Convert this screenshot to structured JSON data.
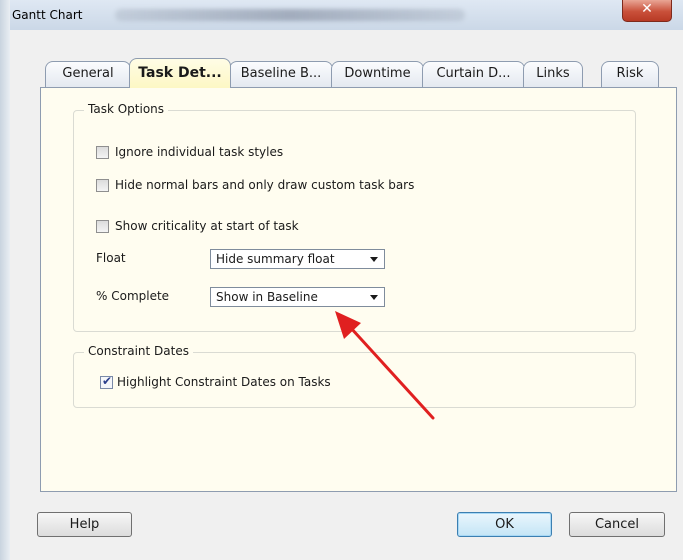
{
  "window": {
    "title": "Gantt Chart",
    "close_glyph": "✕"
  },
  "tabs": [
    {
      "label": "General",
      "active": false
    },
    {
      "label": "Task Det...",
      "active": true
    },
    {
      "label": "Baseline B...",
      "active": false
    },
    {
      "label": "Downtime",
      "active": false
    },
    {
      "label": "Curtain D...",
      "active": false
    },
    {
      "label": "Links",
      "active": false
    },
    {
      "label": "Risk",
      "active": false
    }
  ],
  "task_options": {
    "legend": "Task Options",
    "checkboxes": [
      {
        "label": "Ignore individual task styles",
        "checked": false
      },
      {
        "label": "Hide normal bars and only draw custom task bars",
        "checked": false
      },
      {
        "label": "Show criticality at start of task",
        "checked": false
      }
    ],
    "float_label": "Float",
    "float_value": "Hide summary float",
    "complete_label": "% Complete",
    "complete_value": "Show in Baseline"
  },
  "constraint_dates": {
    "legend": "Constraint Dates",
    "checkbox": {
      "label": "Highlight Constraint Dates on Tasks",
      "checked": true
    }
  },
  "buttons": {
    "help": "Help",
    "ok": "OK",
    "cancel": "Cancel"
  },
  "colors": {
    "active_tab": "#fdf7c4",
    "panel_background": "#fffdf0",
    "close_button": "#c9503a",
    "annotation_arrow": "#e02020"
  },
  "icons": {
    "checkmark": "✔"
  }
}
